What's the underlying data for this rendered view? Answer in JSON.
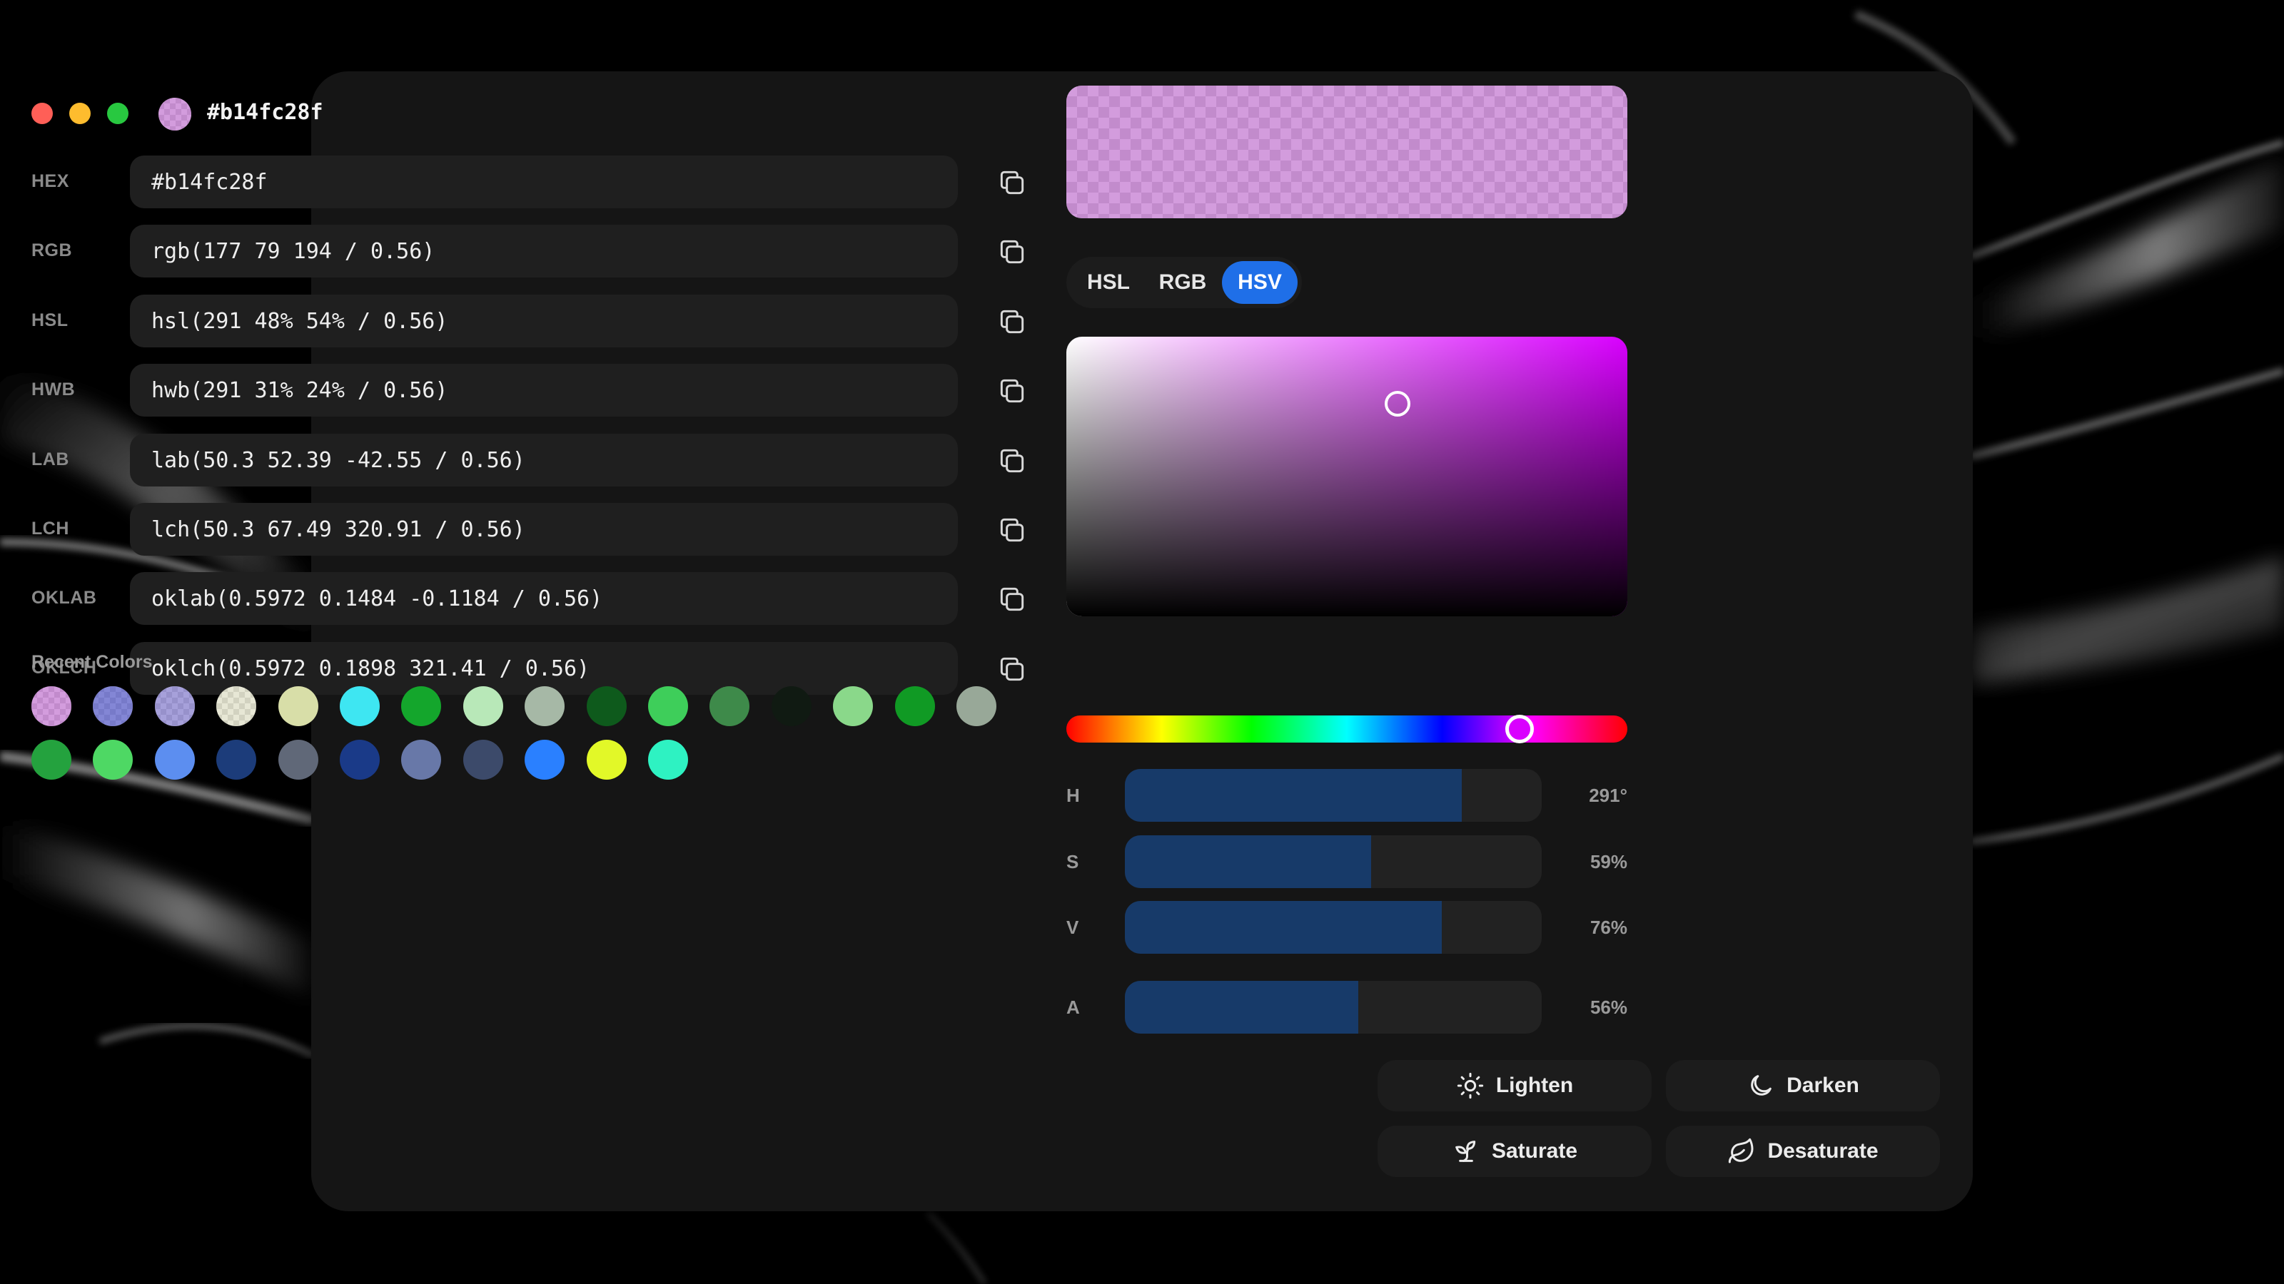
{
  "window": {
    "title": "#b14fc28f",
    "color_hex": "#b14fc28f",
    "traffic_lights": {
      "close": "#ff5f57",
      "minimize": "#febc2e",
      "maximize": "#28c840"
    }
  },
  "formats": [
    {
      "label": "HEX",
      "value": "#b14fc28f"
    },
    {
      "label": "RGB",
      "value": "rgb(177 79 194 / 0.56)"
    },
    {
      "label": "HSL",
      "value": "hsl(291 48% 54% / 0.56)"
    },
    {
      "label": "HWB",
      "value": "hwb(291 31% 24% / 0.56)"
    },
    {
      "label": "LAB",
      "value": "lab(50.3 52.39 -42.55 / 0.56)"
    },
    {
      "label": "LCH",
      "value": "lch(50.3 67.49 320.91 / 0.56)"
    },
    {
      "label": "OKLAB",
      "value": "oklab(0.5972 0.1484 -0.1184 / 0.56)"
    },
    {
      "label": "OKLCH",
      "value": "oklch(0.5972 0.1898 321.41 / 0.56)"
    }
  ],
  "recent": {
    "title": "Recent Colors",
    "colors": [
      "#b14fc28f",
      "#4b4fc2b0",
      "#6b62c29a",
      "#c8c8a070",
      "#d8dea8",
      "#3ee6f2",
      "#14a62c",
      "#b8e8b8",
      "#a6b8a6",
      "#0e5a1c",
      "#3ece5a",
      "#3e8a4a",
      "#101a12",
      "#8ad88a",
      "#109a24",
      "#98a898",
      "#24a23e",
      "#4ed864",
      "#5c8ef0",
      "#1c3c7a",
      "#606878",
      "#1a3a88",
      "#6878a8",
      "#3c4a6a",
      "#2a80ff",
      "#e2f828",
      "#2ef2c2"
    ]
  },
  "picker": {
    "modes": [
      "HSL",
      "RGB",
      "HSV"
    ],
    "active_mode": "HSV",
    "hue": 291,
    "saturation": 0.59,
    "value": 0.76,
    "sliders": [
      {
        "label": "H",
        "value": "291°",
        "fraction": 0.808
      },
      {
        "label": "S",
        "value": "59%",
        "fraction": 0.59
      },
      {
        "label": "V",
        "value": "76%",
        "fraction": 0.76
      },
      {
        "label": "A",
        "value": "56%",
        "fraction": 0.56
      }
    ]
  },
  "actions": {
    "lighten": "Lighten",
    "darken": "Darken",
    "saturate": "Saturate",
    "desaturate": "Desaturate"
  },
  "colors": {
    "accent": "#1f6fe8",
    "slider_fill": "#173a69",
    "panel": "#151515",
    "field": "#1f1f1f"
  }
}
